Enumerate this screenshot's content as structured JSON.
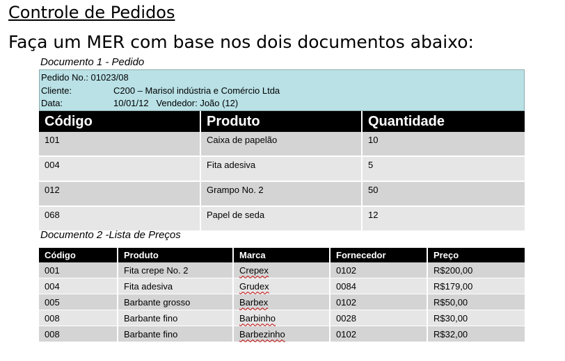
{
  "title": "Controle de Pedidos",
  "subtitle": "Faça um MER com base nos dois documentos abaixo:",
  "doc1": {
    "caption": "Documento 1 - Pedido",
    "order_no_line": "Pedido No.: 01023/08",
    "client_label": "Cliente:",
    "client_value": "C200 – Marisol indústria e Comércio Ltda",
    "date_label": "Data:",
    "date_value": "10/01/12   Vendedor: João (12)",
    "headers": [
      "Código",
      "Produto",
      "Quantidade"
    ],
    "rows": [
      [
        "101",
        "Caixa de papelão",
        "10"
      ],
      [
        "004",
        "Fita adesiva",
        "5"
      ],
      [
        "012",
        "Grampo No. 2",
        "50"
      ],
      [
        "068",
        "Papel de seda",
        "12"
      ]
    ]
  },
  "doc2": {
    "caption": "Documento 2 -Lista de Preços",
    "headers": [
      "Código",
      "Produto",
      "Marca",
      "Fornecedor",
      "Preço"
    ],
    "rows": [
      [
        "001",
        "Fita crepe No. 2",
        "Crepex",
        "0102",
        "R$200,00"
      ],
      [
        "004",
        "Fita adesiva",
        "Grudex",
        "0084",
        "R$179,00"
      ],
      [
        "005",
        "Barbante grosso",
        "Barbex",
        "0102",
        "R$50,00"
      ],
      [
        "008",
        "Barbante fino",
        "Barbinho",
        "0028",
        "R$30,00"
      ],
      [
        "008",
        "Barbante fino",
        "Barbezinho",
        "0102",
        "R$32,00"
      ]
    ]
  }
}
